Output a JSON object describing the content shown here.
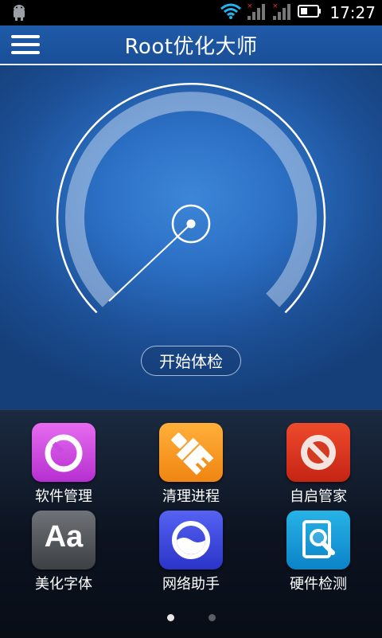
{
  "status_bar": {
    "time": "17:27"
  },
  "header": {
    "title": "Root优化大师"
  },
  "dial": {
    "button_label": "开始体检"
  },
  "grid": {
    "items": [
      {
        "label": "软件管理",
        "icon": "software-manager-icon",
        "color": "#c63ee0"
      },
      {
        "label": "清理进程",
        "icon": "broom-cleanup-icon",
        "color": "#f5951e"
      },
      {
        "label": "自启管家",
        "icon": "forbidden-startup-icon",
        "color": "#d9331e"
      },
      {
        "label": "美化字体",
        "icon": "font-icon",
        "icon_text": "Aa",
        "color": "#55595e"
      },
      {
        "label": "网络助手",
        "icon": "network-assistant-icon",
        "color": "#3f4ae0"
      },
      {
        "label": "硬件检测",
        "icon": "hardware-check-icon",
        "color": "#1a9ad8"
      }
    ]
  },
  "pager": {
    "pages": 2,
    "current": 1
  }
}
